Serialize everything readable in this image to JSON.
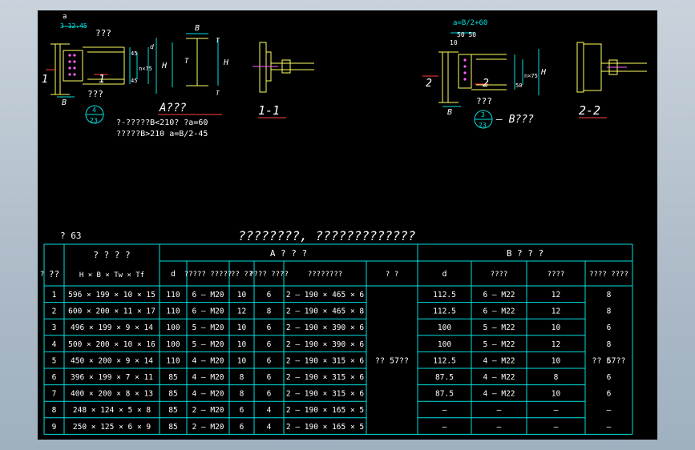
{
  "sheet": {
    "top_left": {
      "a_label": "a",
      "dims_top": "3 12.45",
      "bolt_note": "???",
      "bolt_note2": "???",
      "section_no": "1",
      "B": "B",
      "H": "H",
      "Tw": "T",
      "Tf": "T",
      "d_label": "d",
      "n75": "n×75",
      "n45": "45",
      "n45b": "45",
      "callout_num": "4",
      "callout_den": "23",
      "type_label": "A???",
      "note1": "?-?????B<210?  ?a=60",
      "note2": "?????B>210    a=B/2-45"
    },
    "sec11": {
      "label": "1-1"
    },
    "top_right": {
      "a_formula": "a=B/2+60",
      "d50": "50 50",
      "d10": "10",
      "H": "H",
      "n75": "n×75",
      "d50b": "50",
      "sec_no": "2",
      "note": "???",
      "B": "B",
      "callout_num": "3",
      "callout_den": "23",
      "type_label": "— B???"
    },
    "sec22": {
      "label": "2-2"
    },
    "table": {
      "steel_grade": "?  63",
      "title": "????????, ?????????????",
      "col_no": "??",
      "col_spec": "? ? ? ?",
      "col_spec_sub": "H × B × Tw × Tf",
      "group_a": "A ? ? ?",
      "group_b": "B ? ? ?",
      "a_headers": [
        "d",
        "????? ?????",
        "?? ??",
        "???? ????",
        "????????",
        "? ?"
      ],
      "b_headers": [
        "d",
        "????",
        "????",
        "???? ????",
        "? ?"
      ],
      "merged_a": "?? 57??",
      "merged_b": "?? 57??",
      "rows": [
        {
          "no": "1",
          "spec": "596 × 199 × 10 × 15",
          "ad": "110",
          "abolt": "6 — M20",
          "a3": "10",
          "a4": "6",
          "aplate": "2 — 190 × 465 × 6",
          "bd": "112.5",
          "bbolt": "6 — M22",
          "b3": "12",
          "b4": "8"
        },
        {
          "no": "2",
          "spec": "600 × 200 × 11 × 17",
          "ad": "110",
          "abolt": "6 — M20",
          "a3": "12",
          "a4": "8",
          "aplate": "2 — 190 × 465 × 8",
          "bd": "112.5",
          "bbolt": "6 — M22",
          "b3": "12",
          "b4": "8"
        },
        {
          "no": "3",
          "spec": "496 × 199 × 9 × 14",
          "ad": "100",
          "abolt": "5 — M20",
          "a3": "10",
          "a4": "6",
          "aplate": "2 — 190 × 390 × 6",
          "bd": "100",
          "bbolt": "5 — M22",
          "b3": "10",
          "b4": "6"
        },
        {
          "no": "4",
          "spec": "500 × 200 × 10 × 16",
          "ad": "100",
          "abolt": "5 — M20",
          "a3": "10",
          "a4": "6",
          "aplate": "2 — 190 × 390 × 6",
          "bd": "100",
          "bbolt": "5 — M22",
          "b3": "12",
          "b4": "8"
        },
        {
          "no": "5",
          "spec": "450 × 200 × 9 × 14",
          "ad": "110",
          "abolt": "4 — M20",
          "a3": "10",
          "a4": "6",
          "aplate": "2 — 190 × 315 × 6",
          "bd": "112.5",
          "bbolt": "4 — M22",
          "b3": "10",
          "b4": "6"
        },
        {
          "no": "6",
          "spec": "396 × 199 × 7 × 11",
          "ad": "85",
          "abolt": "4 — M20",
          "a3": "8",
          "a4": "6",
          "aplate": "2 — 190 × 315 × 6",
          "bd": "87.5",
          "bbolt": "4 — M22",
          "b3": "8",
          "b4": "6"
        },
        {
          "no": "7",
          "spec": "400 × 200 × 8 × 13",
          "ad": "85",
          "abolt": "4 — M20",
          "a3": "8",
          "a4": "6",
          "aplate": "2 — 190 × 315 × 6",
          "bd": "87.5",
          "bbolt": "4 — M22",
          "b3": "10",
          "b4": "6"
        },
        {
          "no": "8",
          "spec": "248 × 124 × 5 × 8",
          "ad": "85",
          "abolt": "2 — M20",
          "a3": "6",
          "a4": "4",
          "aplate": "2 — 190 × 165 × 5",
          "bd": "—",
          "bbolt": "—",
          "b3": "—",
          "b4": "—"
        },
        {
          "no": "9",
          "spec": "250 × 125 × 6 × 9",
          "ad": "85",
          "abolt": "2 — M20",
          "a3": "6",
          "a4": "4",
          "aplate": "2 — 190 × 165 × 5",
          "bd": "—",
          "bbolt": "—",
          "b3": "—",
          "b4": "—"
        }
      ]
    }
  },
  "colors": {
    "background": "#000000",
    "line": "#ffffff",
    "yellow": "#ffff60",
    "cyan": "#00e0e0",
    "red": "#ff4040",
    "frame": "#c9d3dc"
  }
}
